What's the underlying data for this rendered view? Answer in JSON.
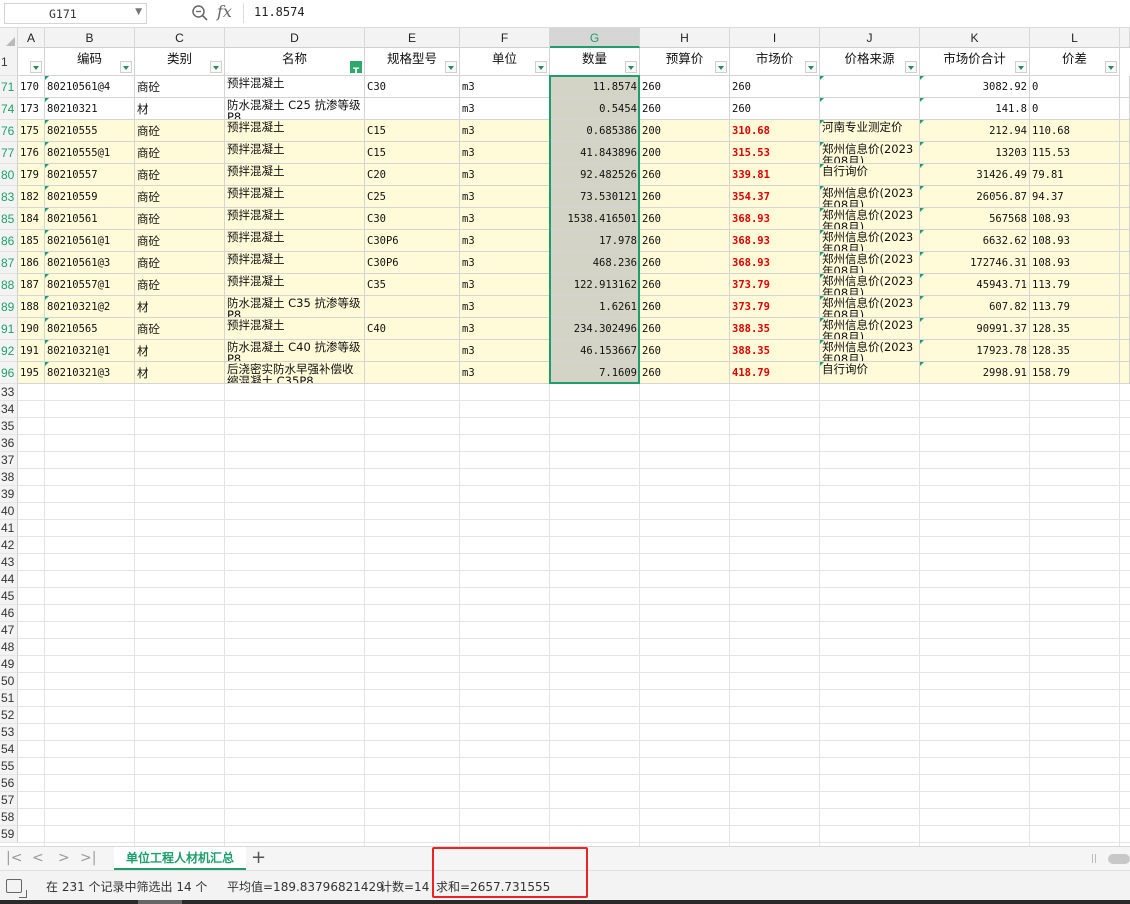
{
  "formula_bar": {
    "cell_ref": "G171",
    "fx_label": "fx",
    "value": "11.8574"
  },
  "columns": [
    "A",
    "B",
    "C",
    "D",
    "E",
    "F",
    "G",
    "H",
    "I",
    "J",
    "K",
    "L"
  ],
  "selected_column": "G",
  "headers": [
    "",
    "编码",
    "类别",
    "名称",
    "规格型号",
    "单位",
    "数量",
    "预算价",
    "市场价",
    "价格来源",
    "市场价合计",
    "价差"
  ],
  "header_row_number": "1",
  "rows": [
    {
      "n": "71",
      "a": "170",
      "b": "80210561@4",
      "c": "商砼",
      "d": "预拌混凝土",
      "e": "C30",
      "f": "m3",
      "g": "11.8574",
      "h": "260",
      "i": "260",
      "j": "",
      "k": "3082.92",
      "l": "0",
      "red": false
    },
    {
      "n": "74",
      "a": "173",
      "b": "80210321",
      "c": "材",
      "d": "防水混凝土 C25 抗渗等级 P8",
      "e": "",
      "f": "m3",
      "g": "0.5454",
      "h": "260",
      "i": "260",
      "j": "",
      "k": "141.8",
      "l": "0",
      "red": false
    },
    {
      "n": "76",
      "a": "175",
      "b": "80210555",
      "c": "商砼",
      "d": "预拌混凝土",
      "e": "C15",
      "f": "m3",
      "g": "0.685386",
      "h": "200",
      "i": "310.68",
      "j": "河南专业测定价",
      "k": "212.94",
      "l": "110.68",
      "red": true
    },
    {
      "n": "77",
      "a": "176",
      "b": "80210555@1",
      "c": "商砼",
      "d": "预拌混凝土",
      "e": "C15",
      "f": "m3",
      "g": "41.843896",
      "h": "200",
      "i": "315.53",
      "j": "郑州信息价(2023年08月)",
      "k": "13203",
      "l": "115.53",
      "red": true
    },
    {
      "n": "80",
      "a": "179",
      "b": "80210557",
      "c": "商砼",
      "d": "预拌混凝土",
      "e": "C20",
      "f": "m3",
      "g": "92.482526",
      "h": "260",
      "i": "339.81",
      "j": "自行询价",
      "k": "31426.49",
      "l": "79.81",
      "red": true
    },
    {
      "n": "83",
      "a": "182",
      "b": "80210559",
      "c": "商砼",
      "d": "预拌混凝土",
      "e": "C25",
      "f": "m3",
      "g": "73.530121",
      "h": "260",
      "i": "354.37",
      "j": "郑州信息价(2023年08月)",
      "k": "26056.87",
      "l": "94.37",
      "red": true
    },
    {
      "n": "85",
      "a": "184",
      "b": "80210561",
      "c": "商砼",
      "d": "预拌混凝土",
      "e": "C30",
      "f": "m3",
      "g": "1538.416501",
      "h": "260",
      "i": "368.93",
      "j": "郑州信息价(2023年08月)",
      "k": "567568",
      "l": "108.93",
      "red": true
    },
    {
      "n": "86",
      "a": "185",
      "b": "80210561@1",
      "c": "商砼",
      "d": "预拌混凝土",
      "e": "C30P6",
      "f": "m3",
      "g": "17.978",
      "h": "260",
      "i": "368.93",
      "j": "郑州信息价(2023年08月)",
      "k": "6632.62",
      "l": "108.93",
      "red": true
    },
    {
      "n": "87",
      "a": "186",
      "b": "80210561@3",
      "c": "商砼",
      "d": "预拌混凝土",
      "e": "C30P6",
      "f": "m3",
      "g": "468.236",
      "h": "260",
      "i": "368.93",
      "j": "郑州信息价(2023年08月)",
      "k": "172746.31",
      "l": "108.93",
      "red": true
    },
    {
      "n": "88",
      "a": "187",
      "b": "80210557@1",
      "c": "商砼",
      "d": "预拌混凝土",
      "e": "C35",
      "f": "m3",
      "g": "122.913162",
      "h": "260",
      "i": "373.79",
      "j": "郑州信息价(2023年08月)",
      "k": "45943.71",
      "l": "113.79",
      "red": true
    },
    {
      "n": "89",
      "a": "188",
      "b": "80210321@2",
      "c": "材",
      "d": "防水混凝土 C35 抗渗等级 P8",
      "e": "",
      "f": "m3",
      "g": "1.6261",
      "h": "260",
      "i": "373.79",
      "j": "郑州信息价(2023年08月)",
      "k": "607.82",
      "l": "113.79",
      "red": true
    },
    {
      "n": "91",
      "a": "190",
      "b": "80210565",
      "c": "商砼",
      "d": "预拌混凝土",
      "e": "C40",
      "f": "m3",
      "g": "234.302496",
      "h": "260",
      "i": "388.35",
      "j": "郑州信息价(2023年08月)",
      "k": "90991.37",
      "l": "128.35",
      "red": true
    },
    {
      "n": "92",
      "a": "191",
      "b": "80210321@1",
      "c": "材",
      "d": "防水混凝土 C40 抗渗等级 P8",
      "e": "",
      "f": "m3",
      "g": "46.153667",
      "h": "260",
      "i": "388.35",
      "j": "郑州信息价(2023年08月)",
      "k": "17923.78",
      "l": "128.35",
      "red": true
    },
    {
      "n": "96",
      "a": "195",
      "b": "80210321@3",
      "c": "材",
      "d": "后浇密实防水早强补偿收缩混凝土 C35P8",
      "e": "",
      "f": "m3",
      "g": "7.1609",
      "h": "260",
      "i": "418.79",
      "j": "自行询价",
      "k": "2998.91",
      "l": "158.79",
      "red": true
    }
  ],
  "empty_row_numbers": [
    "33",
    "34",
    "35",
    "36",
    "37",
    "38",
    "39",
    "40",
    "41",
    "42",
    "43",
    "44",
    "45",
    "46",
    "47",
    "48",
    "49",
    "50",
    "51",
    "52",
    "53",
    "54",
    "55",
    "56",
    "57",
    "58",
    "59"
  ],
  "sheet_tabs": {
    "active": "单位工程人材机汇总",
    "nav": [
      "|<",
      "<",
      ">",
      ">|"
    ],
    "add": "+"
  },
  "status_bar": {
    "filter_info": "在 231 个记录中筛选出 14 个",
    "average": "平均值=189.83796821429",
    "count": "计数=14",
    "sum": "求和=2657.731555"
  },
  "colors": {
    "accent": "#1e9e6e",
    "filtered_row_bg": "#fffbd8",
    "red_price": "#e00000",
    "highlight_box": "#ee2222"
  }
}
